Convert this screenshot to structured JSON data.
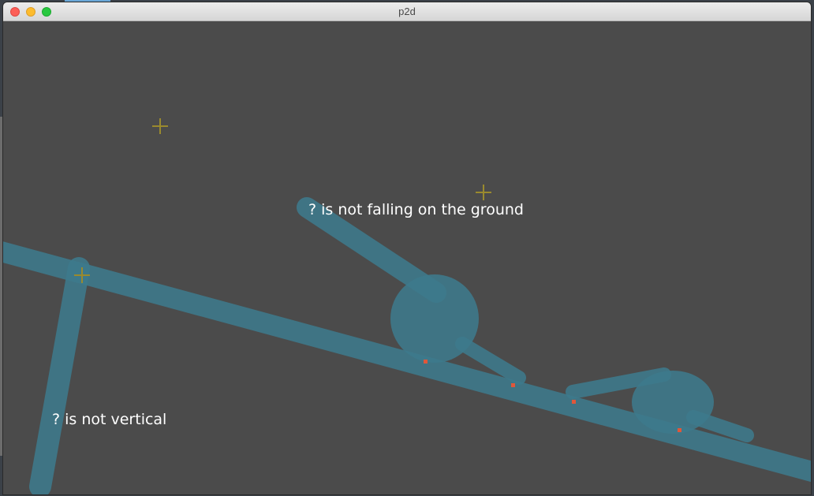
{
  "window": {
    "title": "p2d",
    "buttons": {
      "close": "close",
      "minimize": "minimize",
      "zoom": "zoom"
    }
  },
  "scene": {
    "labels": {
      "falling": "? is not falling on the ground",
      "vertical": "? is not vertical"
    },
    "colors": {
      "background": "#4b4b4b",
      "body_fill": "#3d7a8c",
      "contact_point": "#e0573a",
      "marker": "#9a8a2e",
      "text": "#ffffff"
    },
    "icons": [
      "crosshair-marker-icon",
      "contact-point-icon"
    ]
  }
}
